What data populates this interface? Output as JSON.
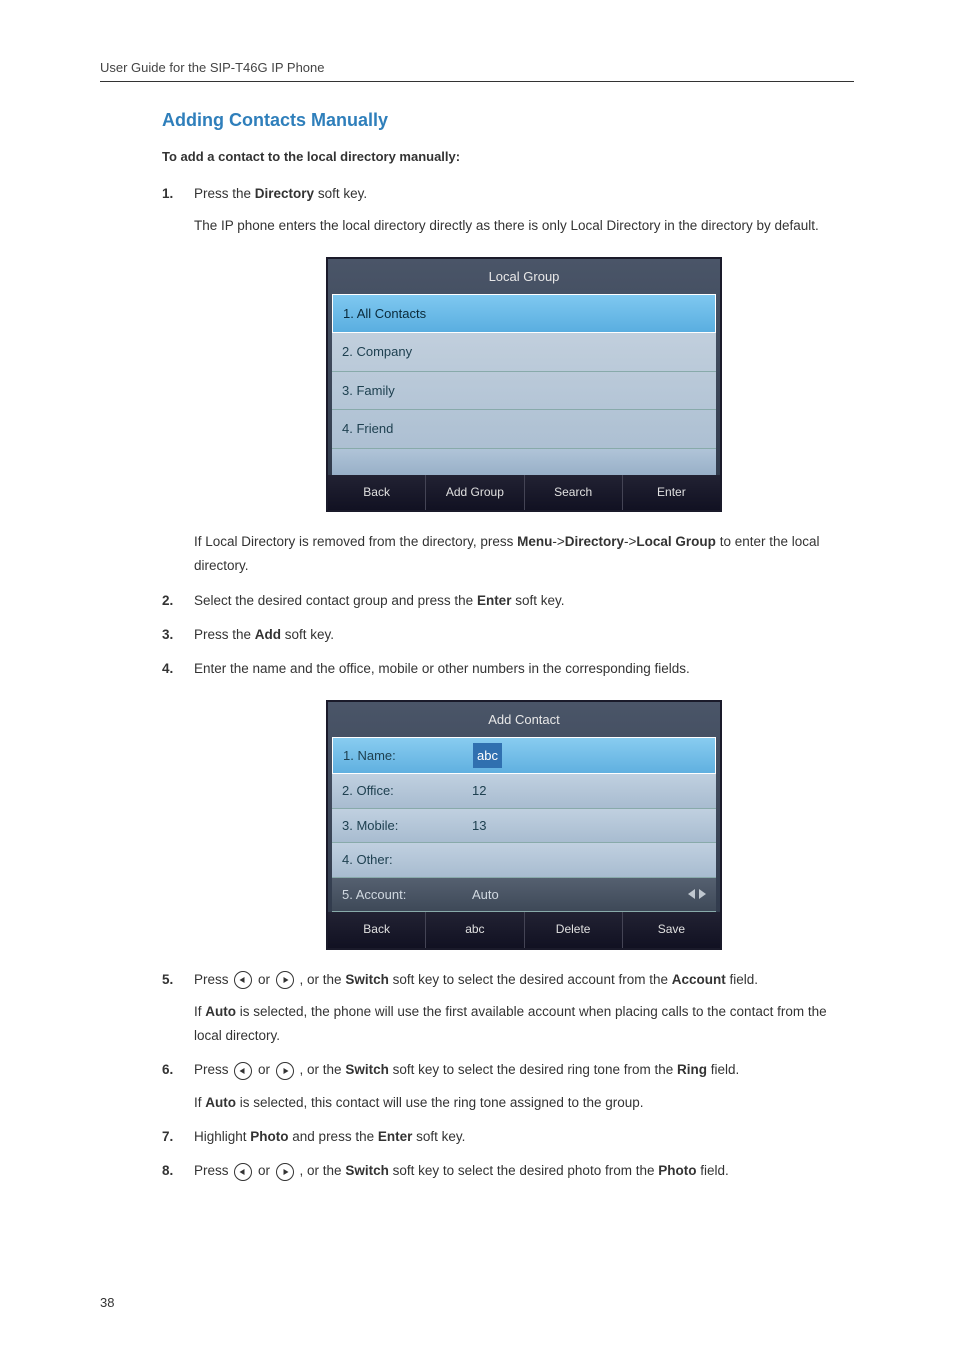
{
  "header": "User Guide for the SIP-T46G IP Phone",
  "section_title": "Adding Contacts Manually",
  "subhead": "To add a contact to the local directory manually:",
  "steps": {
    "s1a": "Press the ",
    "s1b": "Directory",
    "s1c": " soft key.",
    "s1p1": "The IP phone enters the local directory directly as there is only Local Directory in the directory by default.",
    "s1p2a": "If Local Directory is removed from the directory, press ",
    "s1p2b": "Menu",
    "s1p2c": "->",
    "s1p2d": "Directory",
    "s1p2e": "->",
    "s1p2f": "Local Group",
    "s1p2g": " to enter the local directory.",
    "s2a": "Select the desired contact group and press the ",
    "s2b": "Enter",
    "s2c": " soft key.",
    "s3a": "Press the ",
    "s3b": "Add",
    "s3c": " soft key.",
    "s4": "Enter the name and the office, mobile or other numbers in the corresponding fields.",
    "s5a": "Press ",
    "s5b": " or ",
    "s5c": " , or the ",
    "s5d": "Switch",
    "s5e": " soft key to select the desired account from the ",
    "s5f": "Account",
    "s5g": " field.",
    "s5p1a": "If ",
    "s5p1b": "Auto",
    "s5p1c": " is selected, the phone will use the first available account when placing calls to the contact from the local directory.",
    "s6a": "Press ",
    "s6b": " or ",
    "s6c": " , or the ",
    "s6d": "Switch",
    "s6e": " soft key to select the desired ring tone from the ",
    "s6f": "Ring",
    "s6g": " field.",
    "s6p1a": "If ",
    "s6p1b": "Auto",
    "s6p1c": " is selected, this contact will use the ring tone assigned to the group.",
    "s7a": "Highlight ",
    "s7b": "Photo",
    "s7c": " and press the ",
    "s7d": "Enter",
    "s7e": " soft key.",
    "s8a": "Press ",
    "s8b": " or ",
    "s8c": " , or the ",
    "s8d": "Switch",
    "s8e": " soft key to select the desired photo from the ",
    "s8f": "Photo",
    "s8g": " field."
  },
  "screen1": {
    "title": "Local Group",
    "rows": [
      "1. All Contacts",
      "2. Company",
      "3. Family",
      "4. Friend"
    ],
    "softkeys": [
      "Back",
      "Add Group",
      "Search",
      "Enter"
    ]
  },
  "screen2": {
    "title": "Add Contact",
    "rows": [
      {
        "label": "1. Name:",
        "value": "abc"
      },
      {
        "label": "2. Office:",
        "value": "12"
      },
      {
        "label": "3. Mobile:",
        "value": "13"
      },
      {
        "label": "4. Other:",
        "value": ""
      },
      {
        "label": "5. Account:",
        "value": "Auto"
      }
    ],
    "softkeys": [
      "Back",
      "abc",
      "Delete",
      "Save"
    ]
  },
  "page_number": "38"
}
